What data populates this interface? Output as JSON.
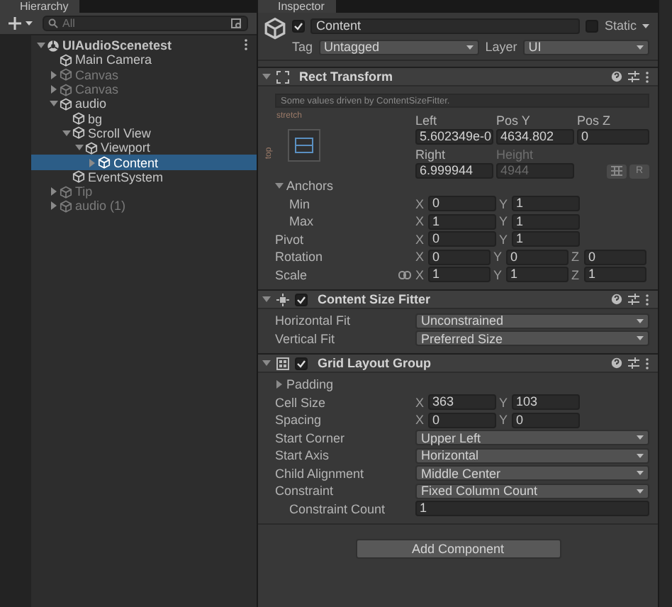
{
  "hierarchy": {
    "title": "Hierarchy",
    "search": {
      "placeholder": "All"
    },
    "items": [
      {
        "kind": "scene",
        "label": "UIAudioScenetest",
        "expanded": true,
        "selected": false,
        "disabled": false,
        "children": [
          {
            "kind": "object",
            "label": "Main Camera",
            "selected": false,
            "disabled": false
          },
          {
            "kind": "object",
            "label": "Canvas",
            "expanded": false,
            "selected": false,
            "disabled": true
          },
          {
            "kind": "object",
            "label": "Canvas",
            "expanded": false,
            "selected": false,
            "disabled": true
          },
          {
            "kind": "object",
            "label": "audio",
            "expanded": true,
            "selected": false,
            "disabled": false,
            "children": [
              {
                "kind": "object",
                "label": "bg",
                "selected": false,
                "disabled": false
              },
              {
                "kind": "object",
                "label": "Scroll View",
                "expanded": true,
                "selected": false,
                "disabled": false,
                "children": [
                  {
                    "kind": "object",
                    "label": "Viewport",
                    "expanded": true,
                    "selected": false,
                    "disabled": false,
                    "children": [
                      {
                        "kind": "object",
                        "label": "Content",
                        "expanded": false,
                        "selected": true,
                        "disabled": false
                      }
                    ]
                  }
                ]
              },
              {
                "kind": "object",
                "label": "EventSystem",
                "selected": false,
                "disabled": false
              }
            ]
          },
          {
            "kind": "object",
            "label": "Tip",
            "expanded": false,
            "selected": false,
            "disabled": true
          },
          {
            "kind": "object",
            "label": "audio (1)",
            "expanded": false,
            "selected": false,
            "disabled": true
          }
        ]
      }
    ]
  },
  "inspector": {
    "title": "Inspector",
    "object": {
      "name": "Content",
      "active": true,
      "static": false,
      "static_label": "Static",
      "tag_label": "Tag",
      "tag": "Untagged",
      "layer_label": "Layer",
      "layer": "UI"
    },
    "components": [
      {
        "kind": "rect_transform",
        "title": "Rect Transform",
        "expanded": true,
        "note": "Some values driven by ContentSizeFitter.",
        "anchor_preset": {
          "horizontal": "stretch",
          "vertical": "top"
        },
        "position": [
          {
            "label": "Left",
            "value": "5.602349e-0",
            "disabled": false
          },
          {
            "label": "Pos Y",
            "value": "4634.802",
            "disabled": false
          },
          {
            "label": "Pos Z",
            "value": "0",
            "disabled": false
          },
          {
            "label": "Right",
            "value": "6.999944",
            "disabled": false
          },
          {
            "label": "Height",
            "value": "4944",
            "disabled": true
          }
        ],
        "raw_button": "R",
        "rows": [
          {
            "kind": "foldout",
            "label": "Anchors",
            "expanded": true,
            "children": [
              {
                "kind": "vector",
                "label": "Min",
                "axes": [
                  {
                    "axis": "X",
                    "value": "0"
                  },
                  {
                    "axis": "Y",
                    "value": "1"
                  }
                ]
              },
              {
                "kind": "vector",
                "label": "Max",
                "axes": [
                  {
                    "axis": "X",
                    "value": "1"
                  },
                  {
                    "axis": "Y",
                    "value": "1"
                  }
                ]
              }
            ]
          },
          {
            "kind": "vector",
            "label": "Pivot",
            "axes": [
              {
                "axis": "X",
                "value": "0"
              },
              {
                "axis": "Y",
                "value": "1"
              }
            ]
          },
          {
            "kind": "vector",
            "label": "Rotation",
            "axes": [
              {
                "axis": "X",
                "value": "0"
              },
              {
                "axis": "Y",
                "value": "0"
              },
              {
                "axis": "Z",
                "value": "0"
              }
            ]
          },
          {
            "kind": "vector",
            "label": "Scale",
            "linked": true,
            "axes": [
              {
                "axis": "X",
                "value": "1"
              },
              {
                "axis": "Y",
                "value": "1"
              },
              {
                "axis": "Z",
                "value": "1"
              }
            ]
          }
        ]
      },
      {
        "kind": "content_size_fitter",
        "title": "Content Size Fitter",
        "enabled": true,
        "expanded": true,
        "rows": [
          {
            "kind": "dropdown",
            "label": "Horizontal Fit",
            "value": "Unconstrained"
          },
          {
            "kind": "dropdown",
            "label": "Vertical Fit",
            "value": "Preferred Size"
          }
        ]
      },
      {
        "kind": "grid_layout_group",
        "title": "Grid Layout Group",
        "enabled": true,
        "expanded": true,
        "rows": [
          {
            "kind": "foldout",
            "label": "Padding",
            "expanded": false
          },
          {
            "kind": "vector",
            "label": "Cell Size",
            "axes": [
              {
                "axis": "X",
                "value": "363"
              },
              {
                "axis": "Y",
                "value": "103"
              }
            ]
          },
          {
            "kind": "vector",
            "label": "Spacing",
            "axes": [
              {
                "axis": "X",
                "value": "0"
              },
              {
                "axis": "Y",
                "value": "0"
              }
            ]
          },
          {
            "kind": "dropdown",
            "label": "Start Corner",
            "value": "Upper Left"
          },
          {
            "kind": "dropdown",
            "label": "Start Axis",
            "value": "Horizontal"
          },
          {
            "kind": "dropdown",
            "label": "Child Alignment",
            "value": "Middle Center"
          },
          {
            "kind": "dropdown",
            "label": "Constraint",
            "value": "Fixed Column Count",
            "children": [
              {
                "kind": "number",
                "label": "Constraint Count",
                "value": "1"
              }
            ]
          }
        ]
      }
    ],
    "add_component": "Add Component"
  }
}
